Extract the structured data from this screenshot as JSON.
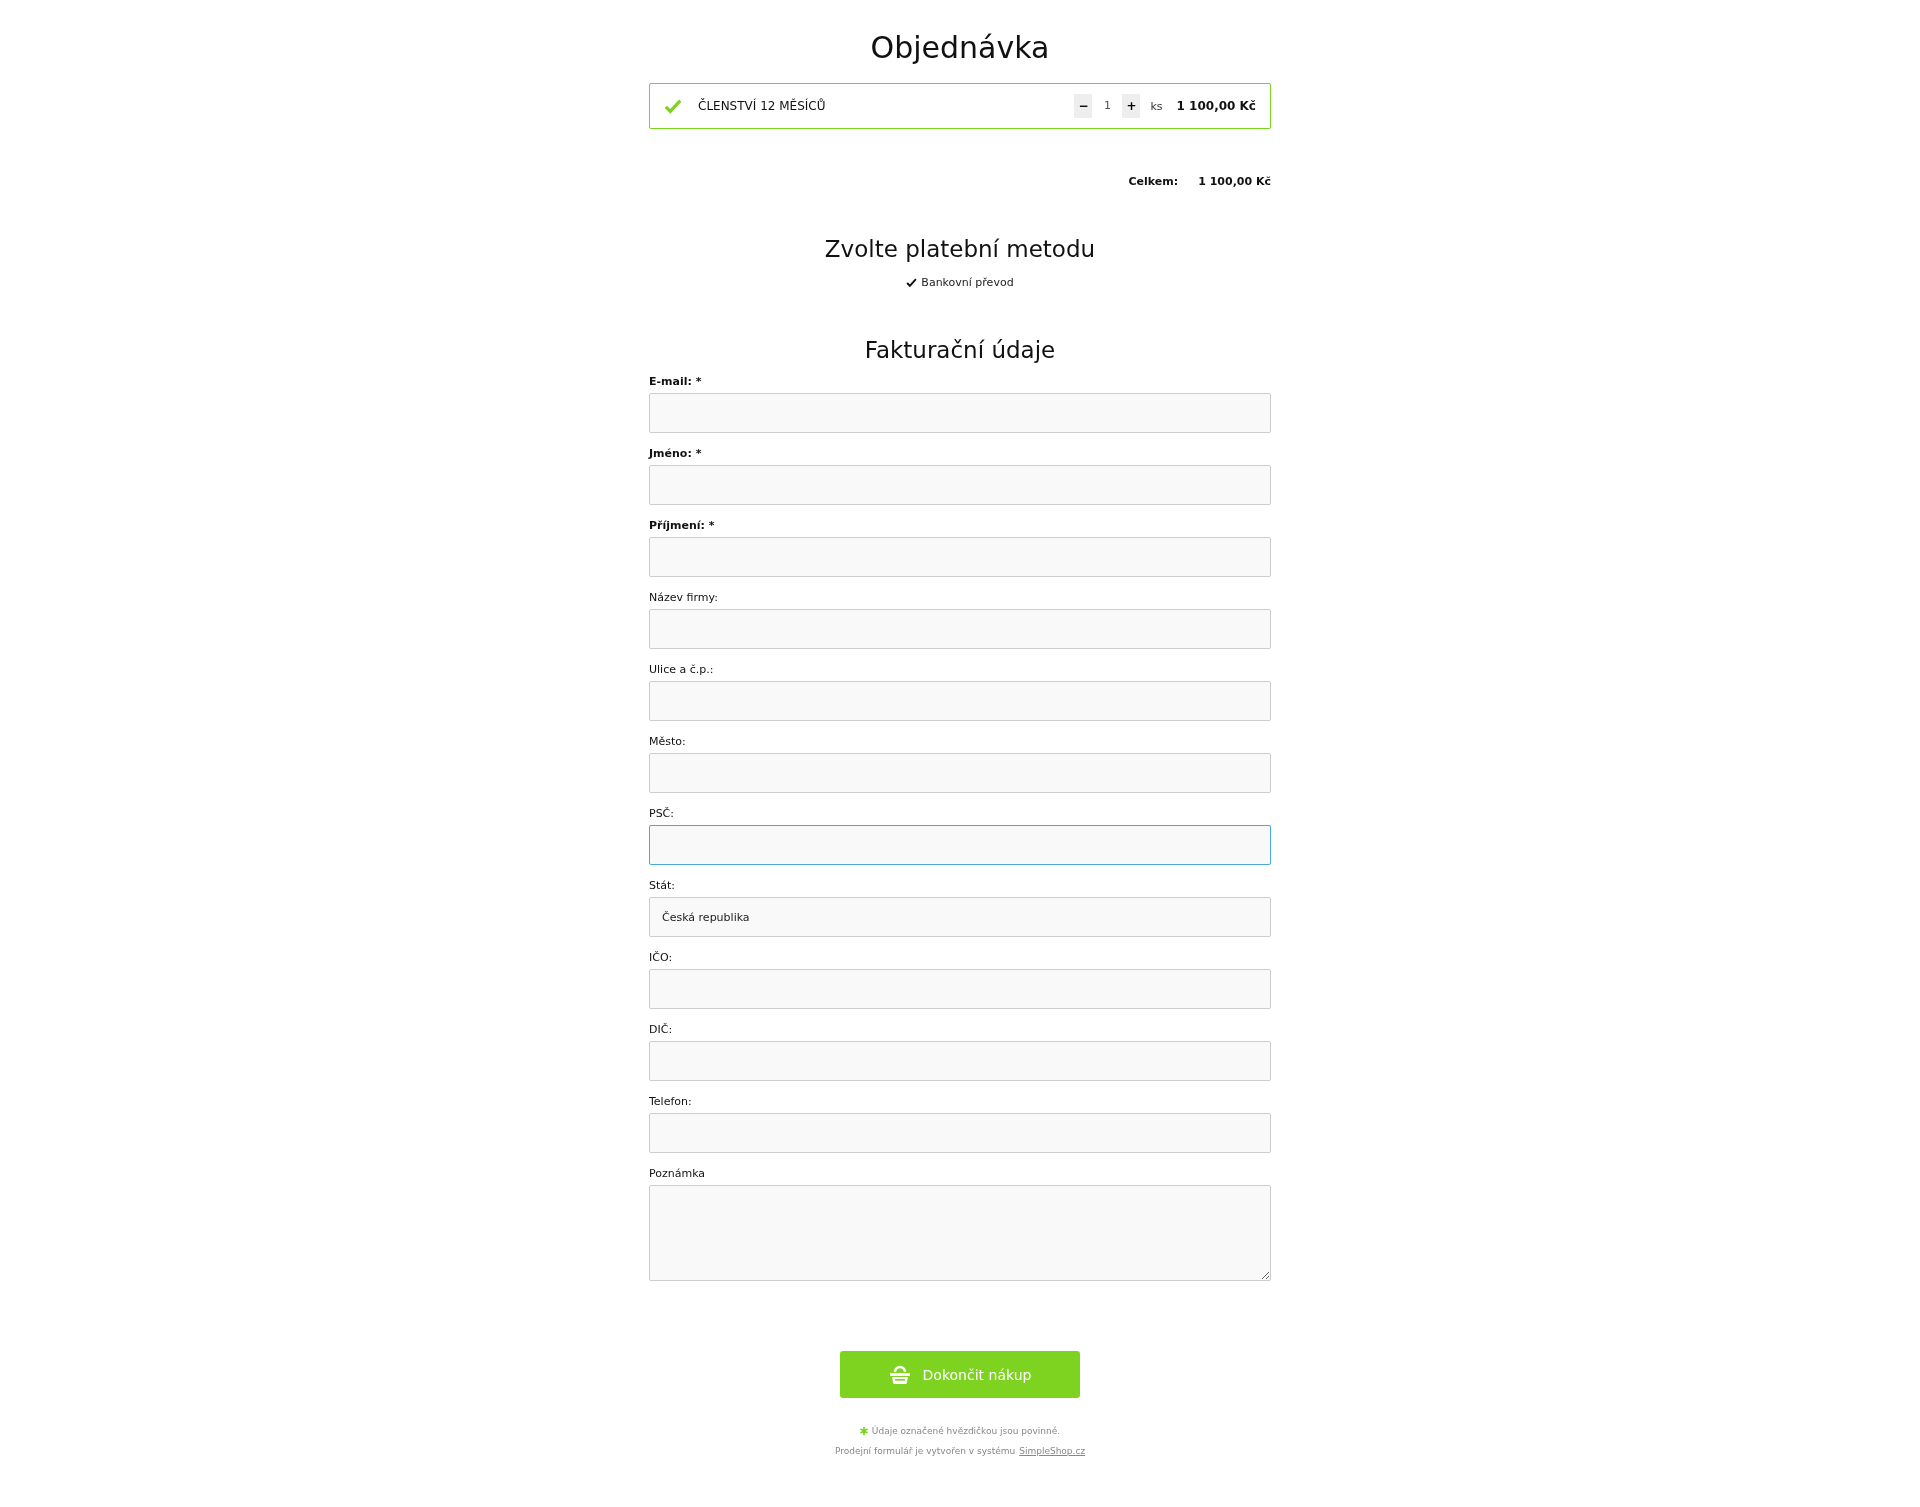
{
  "title": "Objednávka",
  "product": {
    "selected": true,
    "name": "ČLENSTVÍ 12 MĚSÍCŮ",
    "minus": "−",
    "quantity": "1",
    "plus": "+",
    "unit": "ks",
    "price": "1 100,00 Kč"
  },
  "total": {
    "label": "Celkem:",
    "value": "1 100,00 Kč"
  },
  "payment": {
    "heading": "Zvolte platební metodu",
    "methods": [
      {
        "label": "Bankovní převod",
        "selected": true
      }
    ]
  },
  "billing": {
    "heading": "Fakturační údaje",
    "fields": [
      {
        "kind": "text",
        "label": "E-mail: *",
        "required": true,
        "focused": false
      },
      {
        "kind": "text",
        "label": "Jméno: *",
        "required": true,
        "focused": false
      },
      {
        "kind": "text",
        "label": "Příjmení: *",
        "required": true,
        "focused": false
      },
      {
        "kind": "text",
        "label": "Název firmy:",
        "required": false,
        "focused": false
      },
      {
        "kind": "text",
        "label": "Ulice a č.p.:",
        "required": false,
        "focused": false
      },
      {
        "kind": "text",
        "label": "Město:",
        "required": false,
        "focused": false
      },
      {
        "kind": "text",
        "label": "PSČ:",
        "required": false,
        "focused": true
      },
      {
        "kind": "text",
        "label": "Stát:",
        "required": false,
        "focused": false,
        "value": "Česká republika"
      },
      {
        "kind": "text",
        "label": "IČO:",
        "required": false,
        "focused": false
      },
      {
        "kind": "text",
        "label": "DIČ:",
        "required": false,
        "focused": false
      },
      {
        "kind": "text",
        "label": "Telefon:",
        "required": false,
        "focused": false
      },
      {
        "kind": "textarea",
        "label": "Poznámka",
        "required": false,
        "focused": false
      }
    ]
  },
  "submit": "Dokončit nákup",
  "footer": {
    "note": "Údaje označené hvězdičkou jsou povinné.",
    "credit": "Prodejní formulář je vytvořen v systému",
    "link": "SimpleShop.cz"
  }
}
